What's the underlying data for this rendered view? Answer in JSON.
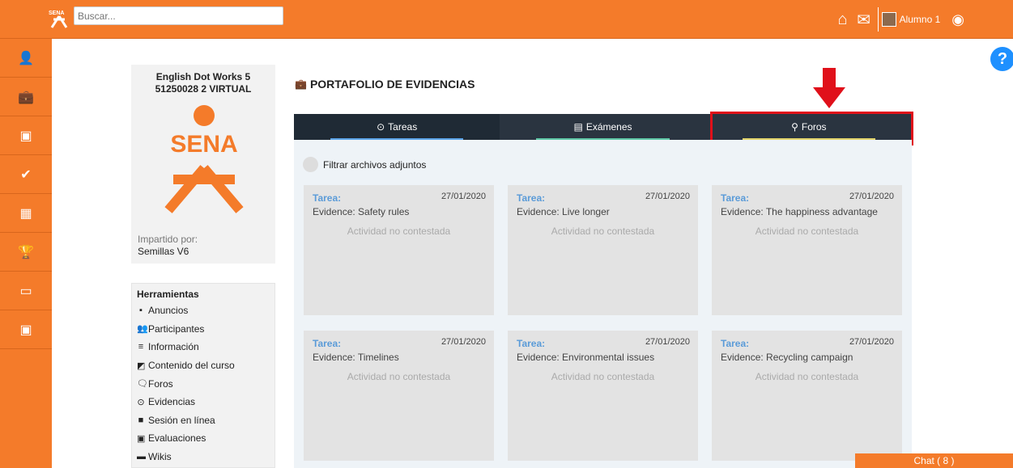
{
  "header": {
    "search_placeholder": "Buscar...",
    "user_name": "Alumno 1"
  },
  "sidebar": {
    "icons": [
      "user-icon",
      "briefcase-icon",
      "calendar-grid-icon",
      "check-circle-icon",
      "calendar-icon",
      "trophy-icon",
      "inbox-icon",
      "calendar-grid-icon"
    ]
  },
  "course": {
    "title_line1": "English Dot Works 5",
    "title_line2": "51250028 2 VIRTUAL",
    "logo_text": "SENA",
    "instructor_label": "Impartido por:",
    "instructor": "Semillas V6"
  },
  "tools": {
    "title": "Herramientas",
    "items": [
      {
        "label": "Anuncios",
        "icon": "▪"
      },
      {
        "label": "Participantes",
        "icon": "👥"
      },
      {
        "label": "Información",
        "icon": "≡"
      },
      {
        "label": "Contenido del curso",
        "icon": "◩"
      },
      {
        "label": "Foros",
        "icon": "🗨"
      },
      {
        "label": "Evidencias",
        "icon": "⊙"
      },
      {
        "label": "Sesión en línea",
        "icon": "■"
      },
      {
        "label": "Evaluaciones",
        "icon": "▣"
      },
      {
        "label": "Wikis",
        "icon": "▬"
      }
    ]
  },
  "portfolio": {
    "title": "PORTAFOLIO DE EVIDENCIAS",
    "tabs": [
      {
        "label": "Tareas",
        "icon": "⊙",
        "color": "#5ba4e8"
      },
      {
        "label": "Exámenes",
        "icon": "▤",
        "color": "#5ec7a6"
      },
      {
        "label": "Foros",
        "icon": "⚲",
        "color": "#e2d46a"
      }
    ],
    "filter_label": "Filtrar archivos adjuntos",
    "cards": [
      {
        "type": "Tarea:",
        "date": "27/01/2020",
        "name": "Evidence: Safety rules",
        "status": "Actividad no contestada"
      },
      {
        "type": "Tarea:",
        "date": "27/01/2020",
        "name": "Evidence: Live longer",
        "status": "Actividad no contestada"
      },
      {
        "type": "Tarea:",
        "date": "27/01/2020",
        "name": "Evidence: The happiness advantage",
        "status": "Actividad no contestada"
      },
      {
        "type": "Tarea:",
        "date": "27/01/2020",
        "name": "Evidence: Timelines",
        "status": "Actividad no contestada"
      },
      {
        "type": "Tarea:",
        "date": "27/01/2020",
        "name": "Evidence: Environmental issues",
        "status": "Actividad no contestada"
      },
      {
        "type": "Tarea:",
        "date": "27/01/2020",
        "name": "Evidence: Recycling campaign",
        "status": "Actividad no contestada"
      }
    ]
  },
  "chat": {
    "label": "Chat ( 8 )"
  },
  "colors": {
    "brand": "#f47b2a",
    "highlight": "#e0101a"
  }
}
